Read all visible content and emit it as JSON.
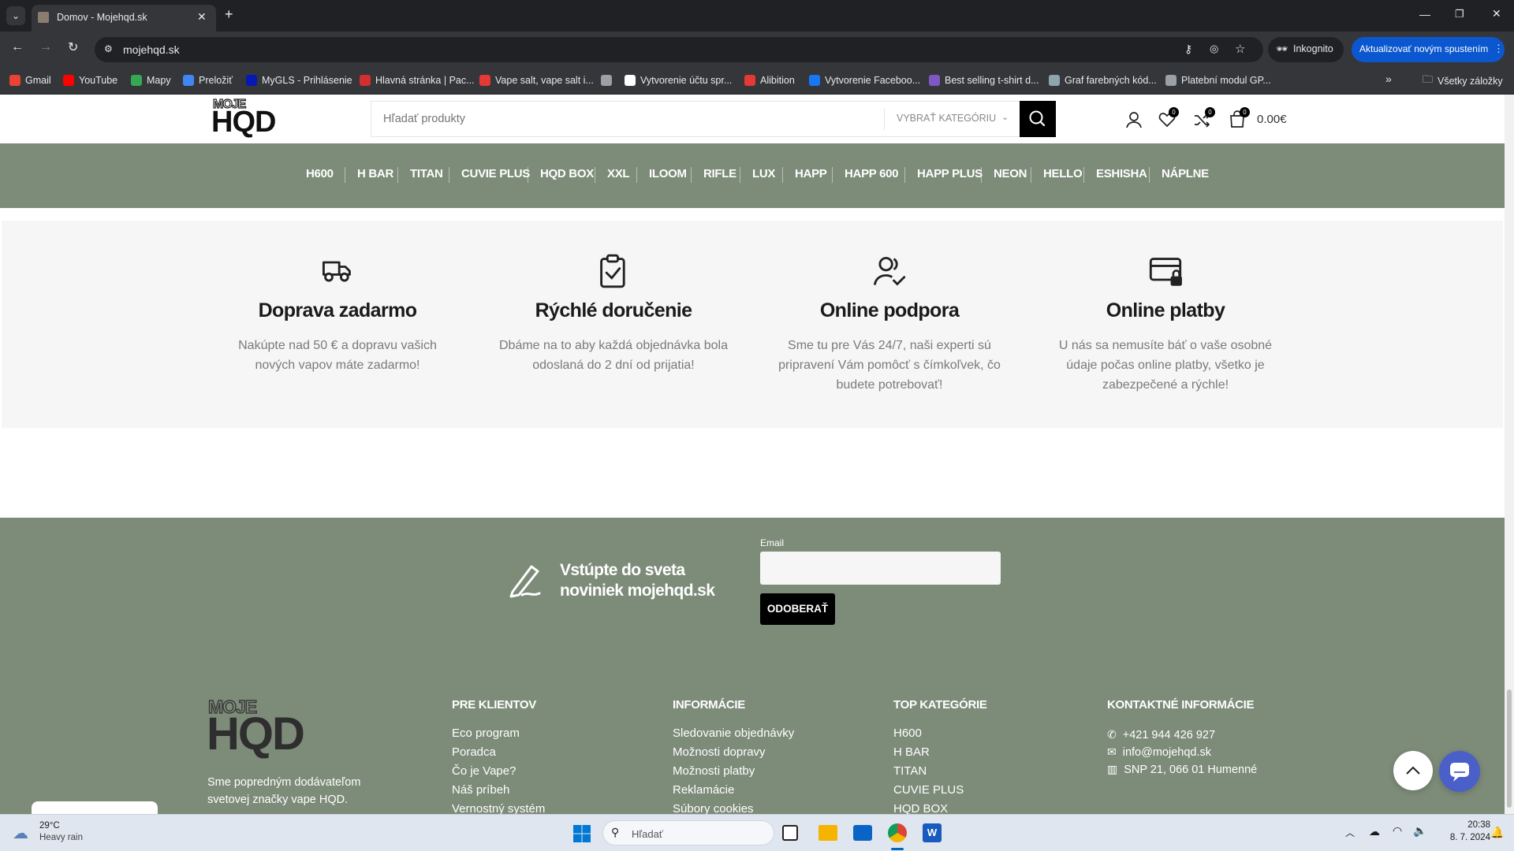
{
  "browser": {
    "tab_title": "Domov - Mojehqd.sk",
    "url": "mojehqd.sk",
    "incognito_label": "Inkognito",
    "update_label": "Aktualizovať novým spustením",
    "bookmarks": [
      {
        "label": "Gmail",
        "color": "#ea4335"
      },
      {
        "label": "YouTube",
        "color": "#ff0000"
      },
      {
        "label": "Mapy",
        "color": "#34a853"
      },
      {
        "label": "Preložiť",
        "color": "#4285f4"
      },
      {
        "label": "MyGLS - Prihlásenie",
        "color": "#061ab1"
      },
      {
        "label": "Hlavná stránka | Pac...",
        "color": "#d32f2f"
      },
      {
        "label": "Vape salt, vape salt i...",
        "color": "#e53935"
      },
      {
        "label": "",
        "color": "#9aa0a6"
      },
      {
        "label": "Vytvorenie účtu spr...",
        "color": "#ffffff"
      },
      {
        "label": "Alibition",
        "color": "#e53935"
      },
      {
        "label": "Vytvorenie Faceboo...",
        "color": "#1877f2"
      },
      {
        "label": "Best selling t-shirt d...",
        "color": "#7e57c2"
      },
      {
        "label": "Graf farebných kód...",
        "color": "#90a4ae"
      },
      {
        "label": "Platební modul GP...",
        "color": "#9aa0a6"
      }
    ],
    "all_bookmarks": "Všetky záložky"
  },
  "header": {
    "logo_top": "MOJE",
    "logo_main": "HQD",
    "search_placeholder": "Hľadať produkty",
    "category_select": "VYBRAŤ KATEGÓRIU",
    "wishlist_count": "0",
    "compare_count": "0",
    "cart_count": "0",
    "cart_total": "0.00€"
  },
  "nav": [
    "H600",
    "H BAR",
    "TITAN",
    "CUVIE PLUS",
    "HQD BOX",
    "XXL",
    "ILOOM",
    "RIFLE",
    "LUX",
    "HAPP",
    "HAPP 600",
    "HAPP PLUS",
    "NEON",
    "HELLO",
    "ESHISHA",
    "NÁPLNE"
  ],
  "features": [
    {
      "icon": "truck-icon",
      "title": "Doprava zadarmo",
      "desc": "Nakúpte nad 50 € a dopravu vašich nových vapov máte zadarmo!"
    },
    {
      "icon": "clipboard-check-icon",
      "title": "Rýchlé doručenie",
      "desc": "Dbáme na to aby každá objednávka bola odoslaná do 2 dní od prijatia!"
    },
    {
      "icon": "user-check-icon",
      "title": "Online podpora",
      "desc": "Sme tu pre Vás 24/7, naši experti sú pripravení Vám pomôcť s čímkoľvek, čo budete potrebovať!"
    },
    {
      "icon": "card-lock-icon",
      "title": "Online platby",
      "desc": "U nás sa nemusíte báť o vaše osobné údaje počas online platby, všetko je zabezpečené a rýchle!"
    }
  ],
  "newsletter": {
    "title_line1": "Vstúpte do sveta",
    "title_line2": "noviniek mojehqd.sk",
    "email_label": "Email",
    "email_value": "",
    "subscribe": "ODOBERAŤ"
  },
  "footer": {
    "logo_top": "MOJE",
    "logo_main": "HQD",
    "about_line1": "Sme popredným dodávateľom",
    "about_line2": "svetovej značky vape HQD.",
    "columns": [
      {
        "title": "PRE KLIENTOV",
        "links": [
          "Eco program",
          "Poradca",
          "Čo je Vape?",
          "Náš príbeh",
          "Vernostný systém"
        ]
      },
      {
        "title": "INFORMÁCIE",
        "links": [
          "Sledovanie objednávky",
          "Možnosti dopravy",
          "Možnosti platby",
          "Reklamácie",
          "Súbory cookies"
        ]
      },
      {
        "title": "TOP KATEGÓRIE",
        "links": [
          "H600",
          "H BAR",
          "TITAN",
          "CUVIE PLUS",
          "HQD BOX"
        ]
      }
    ],
    "contact": {
      "title": "KONTAKTNÉ INFORMÁCIE",
      "phone": "+421 944 426 927",
      "email": "info@mojehqd.sk",
      "address": "SNP 21, 066 01 Humenné"
    }
  },
  "taskbar": {
    "temp": "29°C",
    "weather": "Heavy rain",
    "search": "Hľadať",
    "time": "20:38",
    "date": "8. 7. 2024"
  }
}
